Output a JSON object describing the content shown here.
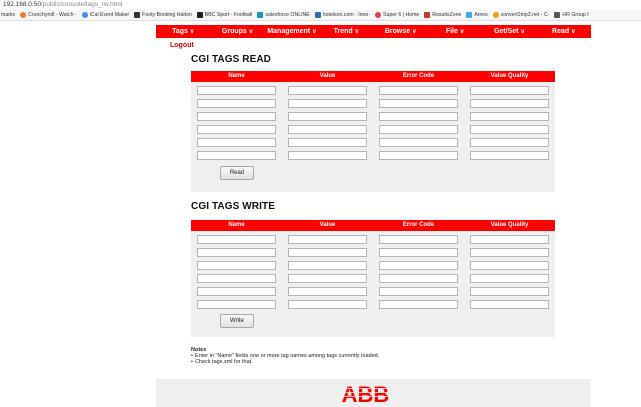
{
  "browser": {
    "url_host": "192.168.0.50",
    "url_path": "/public/console/tags_rw.html",
    "bookmarks": [
      {
        "label": "marks",
        "icon": "none",
        "color": ""
      },
      {
        "label": "Crunchyroll - Watch ·",
        "icon": "crunchyroll-icon",
        "color": "#f47521"
      },
      {
        "label": "iCal Event Maker",
        "icon": "circle-icon",
        "color": "#4a90e2"
      },
      {
        "label": "Footy Booking Halton",
        "icon": "footy-icon",
        "color": "#333333"
      },
      {
        "label": "BBC Sport - Football",
        "icon": "bbc-icon",
        "color": "#222222"
      },
      {
        "label": "salesforce ONLINE",
        "icon": "salesforce-icon",
        "color": "#1798c1"
      },
      {
        "label": "hotelson.com - Inno·",
        "icon": "bars-icon",
        "color": "#2a6ebb"
      },
      {
        "label": "Super 6 | Home",
        "icon": "super6-icon",
        "color": "#e04040"
      },
      {
        "label": "ResultsZone",
        "icon": "resultszone-icon",
        "color": "#c0392b"
      },
      {
        "label": "Ames",
        "icon": "ames-icon",
        "color": "#3fa7e0"
      },
      {
        "label": "convert2mp3.net - C·",
        "icon": "convert-icon",
        "color": "#f39c12"
      },
      {
        "label": "HR Group I",
        "icon": "hr-icon",
        "color": "#555555"
      }
    ]
  },
  "nav": {
    "items": [
      "Tags",
      "Groups",
      "Management",
      "Trend",
      "Browse",
      "File",
      "Get/Set",
      "Read"
    ],
    "logout": "Logout"
  },
  "read_section": {
    "title": "CGI TAGS READ",
    "columns": [
      "Name",
      "Value",
      "Error Code",
      "Value Quality"
    ],
    "row_count": 6,
    "button": "Read"
  },
  "write_section": {
    "title": "CGI TAGS WRITE",
    "columns": [
      "Name",
      "Value",
      "Error Code",
      "Value Quality"
    ],
    "row_count": 6,
    "button": "Write"
  },
  "notes": {
    "heading": "Notes",
    "items": [
      "Enter in \"Name\" fields one or more tag names among tags currently loaded.",
      "Check tags.xml for that."
    ]
  },
  "footer": {
    "logo_text": "ABB",
    "logo_color": "#ff0000"
  },
  "colors": {
    "accent": "#ff0000",
    "panel_bg": "#efefef"
  }
}
